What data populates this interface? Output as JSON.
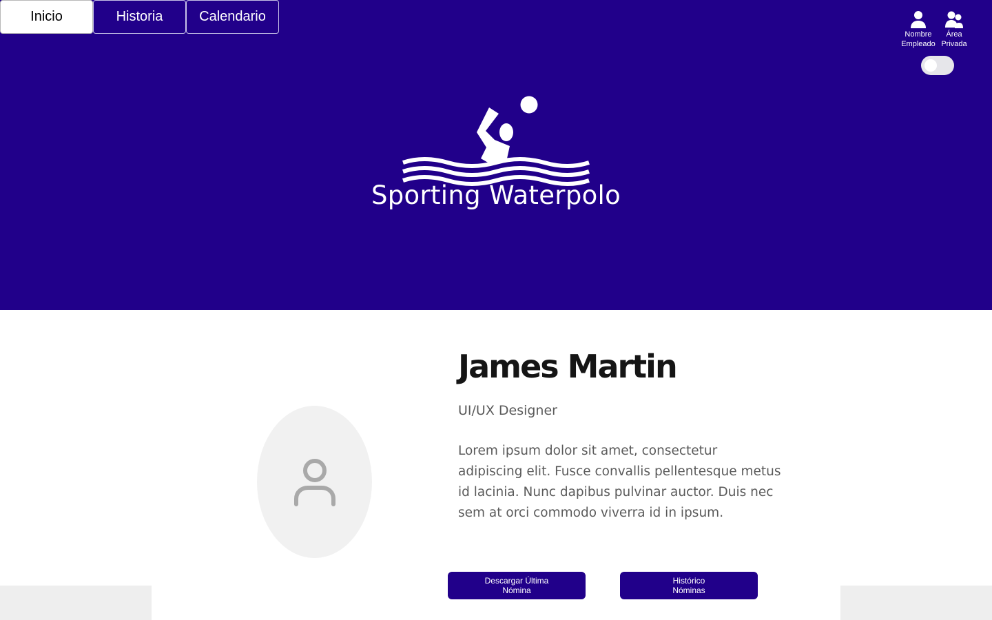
{
  "nav": {
    "tabs": [
      {
        "label": "Inicio",
        "active": true
      },
      {
        "label": "Historia",
        "active": false
      },
      {
        "label": "Calendario",
        "active": false
      }
    ]
  },
  "header": {
    "employee": {
      "label": "Nombre\nEmpleado",
      "icon": "user-icon"
    },
    "private_area": {
      "label": "Área\nPrivada",
      "icon": "users-icon"
    },
    "toggle": {
      "state": "off"
    }
  },
  "brand": {
    "name": "Sporting Waterpolo",
    "logo_icon": "waterpolo-swimmer-icon"
  },
  "profile": {
    "name": "James Martin",
    "role": "UI/UX Designer",
    "bio": "Lorem ipsum dolor sit amet, consectetur adipiscing elit. Fusce convallis pellentesque metus id lacinia. Nunc dapibus pulvinar auctor. Duis nec sem at orci commodo viverra id in ipsum.",
    "avatar_icon": "user-placeholder-icon"
  },
  "actions": {
    "download_last": "Descargar Última\nNómina",
    "history": "Histórico\nNóminas"
  },
  "colors": {
    "primary": "#21008a",
    "background": "#ffffff",
    "band": "#eeeeee"
  }
}
